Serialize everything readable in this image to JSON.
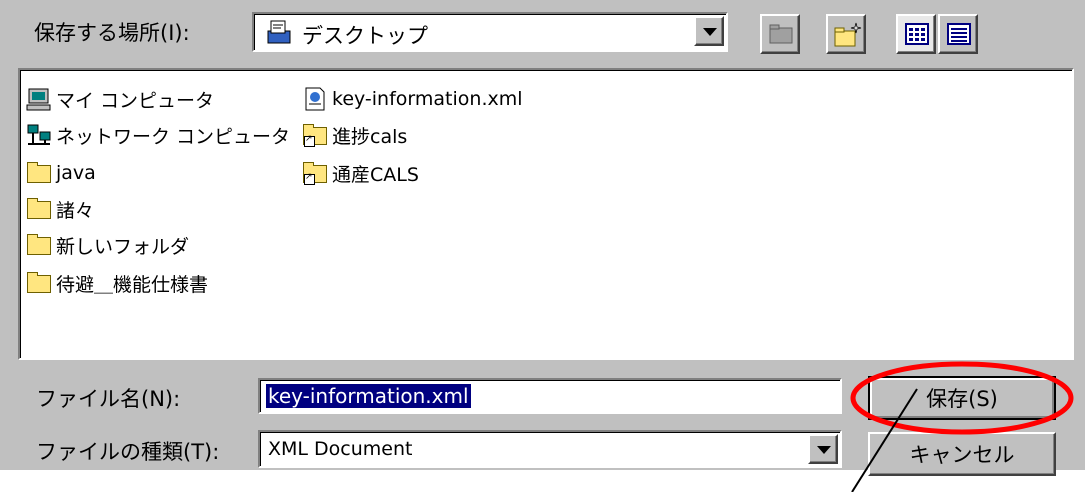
{
  "save_location": {
    "label": "保存する場所(I):",
    "current": "デスクトップ",
    "icons": {
      "location": "desktop-icon",
      "dropdown": "chevron-down-icon"
    }
  },
  "toolbar": {
    "buttons": [
      {
        "name": "up-one-level",
        "icon": "folder-up-icon"
      },
      {
        "name": "create-new-folder",
        "icon": "new-folder-icon"
      },
      {
        "name": "list-view",
        "icon": "list-view-icon"
      },
      {
        "name": "details-view",
        "icon": "details-view-icon"
      }
    ]
  },
  "files": [
    {
      "name": "マイ コンピュータ",
      "icon": "computer-icon"
    },
    {
      "name": "ネットワーク コンピュータ",
      "icon": "network-icon"
    },
    {
      "name": "java",
      "icon": "folder-icon"
    },
    {
      "name": "諸々",
      "icon": "folder-icon"
    },
    {
      "name": "新しいフォルダ",
      "icon": "folder-icon"
    },
    {
      "name": "待避＿機能仕様書",
      "icon": "folder-icon"
    },
    {
      "name": "key-information.xml",
      "icon": "xml-file-icon"
    },
    {
      "name": "進捗cals",
      "icon": "folder-shortcut-icon"
    },
    {
      "name": "通産CALS",
      "icon": "folder-shortcut-icon"
    }
  ],
  "filename": {
    "label": "ファイル名(N):",
    "value": "key-information.xml"
  },
  "filetype": {
    "label": "ファイルの種類(T):",
    "value": "XML Document"
  },
  "buttons": {
    "save": "保存(S)",
    "cancel": "キャンセル"
  },
  "colors": {
    "dialog_bg": "#c0c0c0",
    "selection": "#000080",
    "highlight_circle": "#ff0000"
  }
}
